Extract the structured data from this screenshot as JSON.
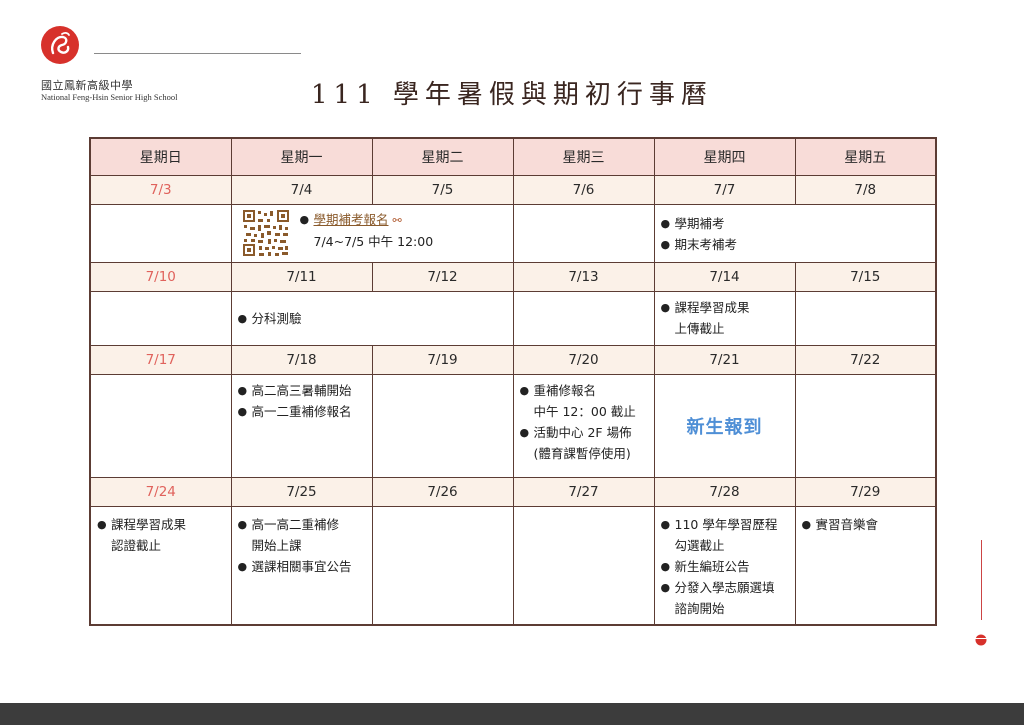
{
  "header": {
    "school_cn": "國立鳳新高級中學",
    "school_en": "National Feng-Hsin Senior High School",
    "title": "111 學年暑假與期初行事曆"
  },
  "colors": {
    "header_bg": "#f8dcd8",
    "date_bg": "#fbf1e8",
    "border": "#5c3c34",
    "sunday": "#e0625c",
    "highlight": "#4f8fd6",
    "logo": "#d7312b"
  },
  "calendar": {
    "days": [
      "星期日",
      "星期一",
      "星期二",
      "星期三",
      "星期四",
      "星期五"
    ],
    "weeks": [
      {
        "dates": [
          "7/3",
          "7/4",
          "7/5",
          "7/6",
          "7/7",
          "7/8"
        ]
      },
      {
        "dates": [
          "7/10",
          "7/11",
          "7/12",
          "7/13",
          "7/14",
          "7/15"
        ]
      },
      {
        "dates": [
          "7/17",
          "7/18",
          "7/19",
          "7/20",
          "7/21",
          "7/22"
        ]
      },
      {
        "dates": [
          "7/24",
          "7/25",
          "7/26",
          "7/27",
          "7/28",
          "7/29"
        ]
      }
    ],
    "events": {
      "w1_mon_title": "學期補考報名",
      "w1_mon_detail": "7/4~7/5 中午 12:00",
      "w1_thu": [
        "學期補考",
        "期末考補考"
      ],
      "w2_mon": "分科測驗",
      "w2_thu": "課程學習成果\n上傳截止",
      "w3_mon": [
        "高二高三暑輔開始",
        "高一二重補修報名"
      ],
      "w3_wed": [
        "重補修報名\n中午 12：00 截止",
        "活動中心 2F 場佈\n(體育課暫停使用)"
      ],
      "w3_thu": "新生報到",
      "w4_sun": "課程學習成果\n認證截止",
      "w4_mon": [
        "高一高二重補修\n開始上課",
        "選課相關事宜公告"
      ],
      "w4_thu": [
        "110 學年學習歷程\n勾選截止",
        "新生編班公告",
        "分發入學志願選填\n諮詢開始"
      ],
      "w4_fri": "實習音樂會"
    }
  }
}
